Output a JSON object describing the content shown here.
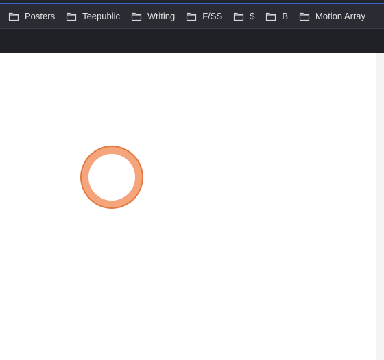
{
  "bookmarks_bar": {
    "items": [
      {
        "label": "Posters",
        "icon": "folder-icon"
      },
      {
        "label": "Teepublic",
        "icon": "folder-icon"
      },
      {
        "label": "Writing",
        "icon": "folder-icon"
      },
      {
        "label": "F/SS",
        "icon": "folder-icon"
      },
      {
        "label": "$",
        "icon": "folder-icon"
      },
      {
        "label": "B",
        "icon": "folder-icon"
      },
      {
        "label": "Motion Array",
        "icon": "folder-icon"
      }
    ]
  },
  "colors": {
    "bookmarks_bar_bg": "#292c32",
    "toolbar_bg": "#1f2126",
    "accent_line": "#3f63c9",
    "bookmark_text": "#e3e3e3",
    "click_ring_fill": "#f4a57c",
    "click_ring_stroke": "#e3793f"
  }
}
